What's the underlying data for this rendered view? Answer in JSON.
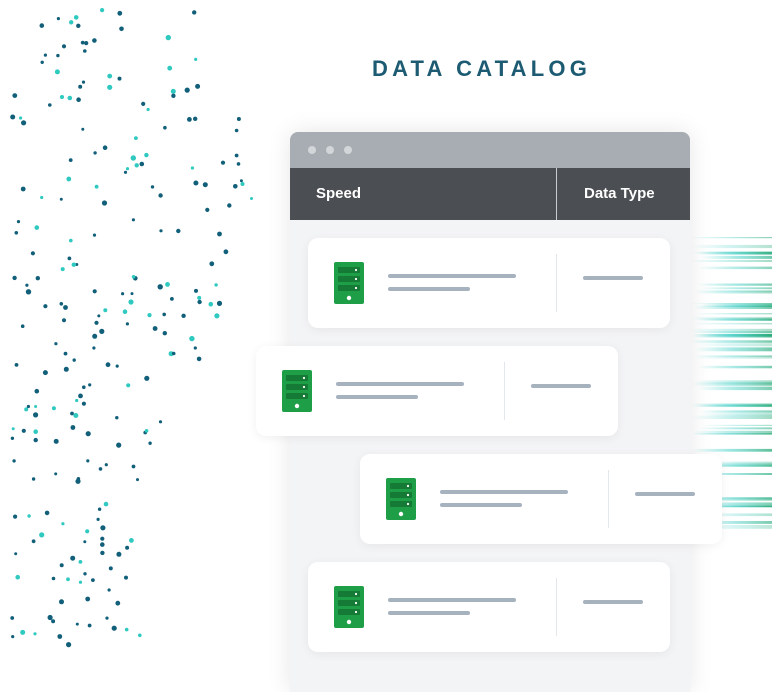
{
  "title": "DATA CATALOG",
  "table": {
    "col_speed": "Speed",
    "col_type": "Data Type",
    "row_count": 4
  },
  "colors": {
    "dot_dark": "#125f7a",
    "dot_teal": "#2fc9c0",
    "server_green": "#1f9e48",
    "header_bg": "#4b4e52",
    "titlebar_bg": "#a7adb2",
    "placeholder_bar": "#a7b2bf",
    "title_text": "#1d5b72"
  },
  "icons": [
    "server-icon",
    "window-control-dot"
  ]
}
